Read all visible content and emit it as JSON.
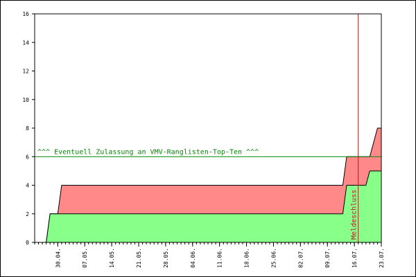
{
  "chart_data": {
    "type": "area",
    "title": "",
    "xlabel": "",
    "ylabel": "",
    "ylim": [
      0,
      16
    ],
    "yticks": [
      "0",
      "2",
      "4",
      "6",
      "8",
      "10",
      "12",
      "14",
      "16"
    ],
    "xtick_labels": [
      "30.04.",
      "07.05.",
      "14.05.",
      "21.05.",
      "28.05.",
      "04.06.",
      "11.06.",
      "18.06.",
      "25.06.",
      "02.07.",
      "09.07.",
      "16.07.",
      "23.07."
    ],
    "xlim": [
      "2023-04-24",
      "2023-07-23"
    ],
    "grid": false,
    "series": [
      {
        "color": "#88ff88",
        "x": [
          "2023-04-24",
          "2023-04-27",
          "2023-04-28",
          "2023-07-13",
          "2023-07-14",
          "2023-07-19",
          "2023-07-20",
          "2023-07-23"
        ],
        "values": [
          0,
          0,
          2,
          2,
          4,
          4,
          5,
          5
        ]
      },
      {
        "color": "#ff8888",
        "x": [
          "2023-04-24",
          "2023-04-27",
          "2023-04-28",
          "2023-04-30",
          "2023-05-01",
          "2023-07-13",
          "2023-07-14",
          "2023-07-20",
          "2023-07-21",
          "2023-07-22",
          "2023-07-23"
        ],
        "values": [
          0,
          0,
          2,
          2,
          4,
          4,
          6,
          6,
          7,
          8,
          8
        ]
      }
    ],
    "hline": {
      "y": 6,
      "label": "^^^ Eventuell Zulassung an VMV-Ranglisten-Top-Ten ^^^",
      "color": "#008800"
    },
    "vline": {
      "x": "2023-07-17",
      "label": "Meldeschluss",
      "color": "#aa2222"
    }
  }
}
